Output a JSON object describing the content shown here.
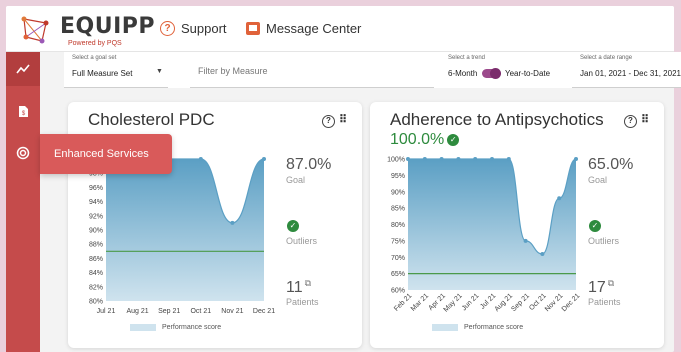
{
  "app": {
    "logo_text": "EQUIPP",
    "logo_sub": "Powered by PQS",
    "support_label": "Support",
    "message_label": "Message Center"
  },
  "sidebar": {
    "flyout_label": "Enhanced Services",
    "icons": [
      "trend-icon",
      "document-icon",
      "services-icon"
    ]
  },
  "filters": {
    "goal_set_label": "Select a goal set",
    "goal_set_value": "Full Measure Set",
    "measure_placeholder": "Filter by Measure",
    "trend_label": "Select a trend",
    "trend_left": "6-Month",
    "trend_right": "Year-to-Date",
    "date_label": "Select a date range",
    "date_value": "Jan 01, 2021 - Dec 31, 2021"
  },
  "cards": [
    {
      "title": "Cholesterol PDC",
      "goal": "87.0%",
      "goal_label": "Goal",
      "outliers_label": "Outliers",
      "patients": "11",
      "patients_label": "Patients",
      "legend": "Performance score"
    },
    {
      "title": "Adherence to Antipsychotics",
      "score": "100.0%",
      "goal": "65.0%",
      "goal_label": "Goal",
      "outliers_label": "Outliers",
      "patients": "17",
      "patients_label": "Patients",
      "legend": "Performance score"
    }
  ],
  "chart_data": [
    {
      "type": "area",
      "series_label": "Performance score",
      "x": [
        "Jul 21",
        "Aug 21",
        "Sep 21",
        "Oct 21",
        "Nov 21",
        "Dec 21"
      ],
      "values": [
        100,
        100,
        100,
        100,
        91,
        100
      ],
      "goal": 87,
      "yticks": [
        "80%",
        "82%",
        "84%",
        "86%",
        "88%",
        "90%",
        "92%",
        "94%",
        "96%",
        "98%"
      ],
      "ylim": [
        80,
        100
      ],
      "color": "#5b9fc4",
      "goal_color": "#4a9a4a"
    },
    {
      "type": "area",
      "series_label": "Performance score",
      "x": [
        "Feb 21",
        "Mar 21",
        "Apr 21",
        "May 21",
        "Jun 21",
        "Jul 21",
        "Aug 21",
        "Sep 21",
        "Oct 21",
        "Nov 21",
        "Dec 21"
      ],
      "values": [
        100,
        100,
        100,
        100,
        100,
        100,
        100,
        75,
        71,
        88,
        100
      ],
      "goal": 65,
      "yticks": [
        "60%",
        "65%",
        "70%",
        "75%",
        "80%",
        "85%",
        "90%",
        "95%",
        "100%"
      ],
      "ylim": [
        60,
        100
      ],
      "color": "#5b9fc4",
      "goal_color": "#4a9a4a"
    }
  ]
}
